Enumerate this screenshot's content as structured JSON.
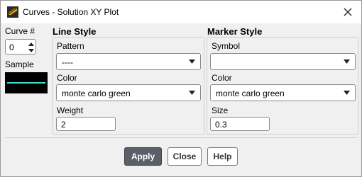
{
  "window": {
    "title": "Curves - Solution XY Plot"
  },
  "curve": {
    "label": "Curve #",
    "value": "0",
    "sample_label": "Sample"
  },
  "line_style": {
    "heading": "Line Style",
    "pattern_label": "Pattern",
    "pattern_value": "----",
    "color_label": "Color",
    "color_value": "monte carlo green",
    "weight_label": "Weight",
    "weight_value": "2"
  },
  "marker_style": {
    "heading": "Marker Style",
    "symbol_label": "Symbol",
    "symbol_value": "",
    "color_label": "Color",
    "color_value": "monte carlo green",
    "size_label": "Size",
    "size_value": "0.3"
  },
  "buttons": {
    "apply": "Apply",
    "close": "Close",
    "help": "Help"
  },
  "colors": {
    "sample_line": "#40e0d0",
    "apply_bg": "#5a5f69"
  },
  "icons": {
    "app": "ansys-fluent-icon",
    "close": "close-icon",
    "dropdown": "chevron-down-icon"
  }
}
